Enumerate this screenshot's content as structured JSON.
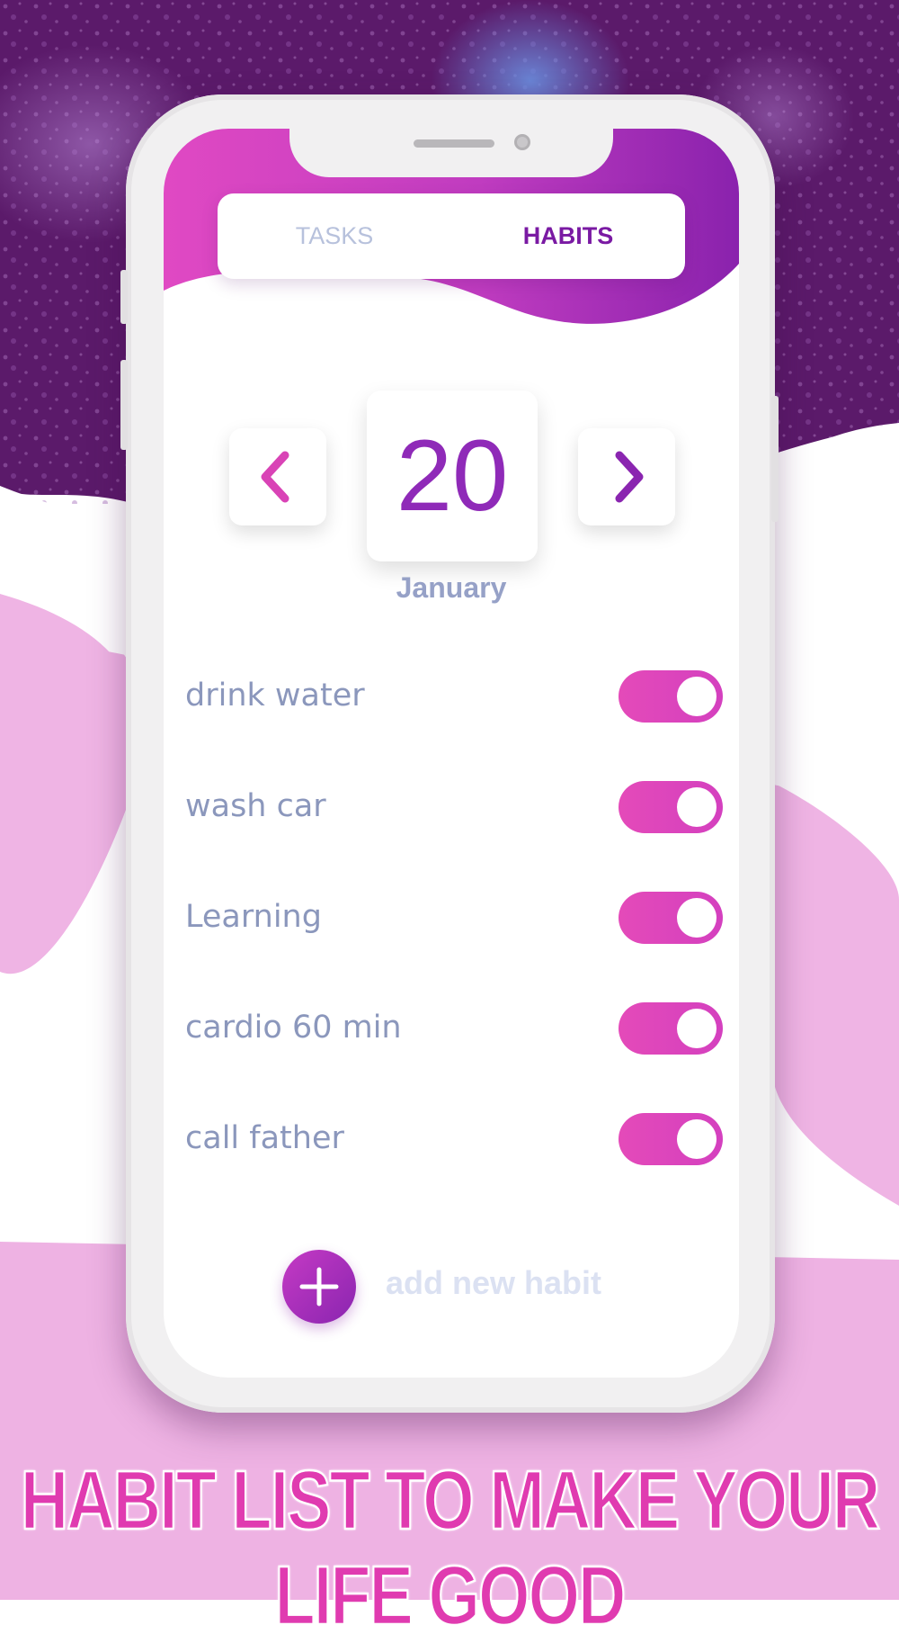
{
  "colors": {
    "accent_pink": "#e03bb0",
    "accent_purple": "#7a1aa3",
    "toggle_on": "#e44ab9",
    "text_muted": "#8b97bc",
    "background_purple": "#5b1a6a",
    "background_pink": "#eeb2e3"
  },
  "tabs": {
    "tasks_label": "TASKS",
    "habits_label": "HABITS",
    "active": "HABITS"
  },
  "date": {
    "day": "20",
    "month": "January",
    "prev_icon": "chevron-left-icon",
    "next_icon": "chevron-right-icon"
  },
  "habits": [
    {
      "label": "drink water",
      "enabled": true
    },
    {
      "label": "wash car",
      "enabled": true
    },
    {
      "label": "Learning",
      "enabled": true
    },
    {
      "label": "cardio 60 min",
      "enabled": true
    },
    {
      "label": "call father",
      "enabled": true
    }
  ],
  "add_habit": {
    "label": "add new habit",
    "icon": "plus-icon"
  },
  "tagline": "HABIT LIST TO MAKE YOUR LIFE GOOD"
}
